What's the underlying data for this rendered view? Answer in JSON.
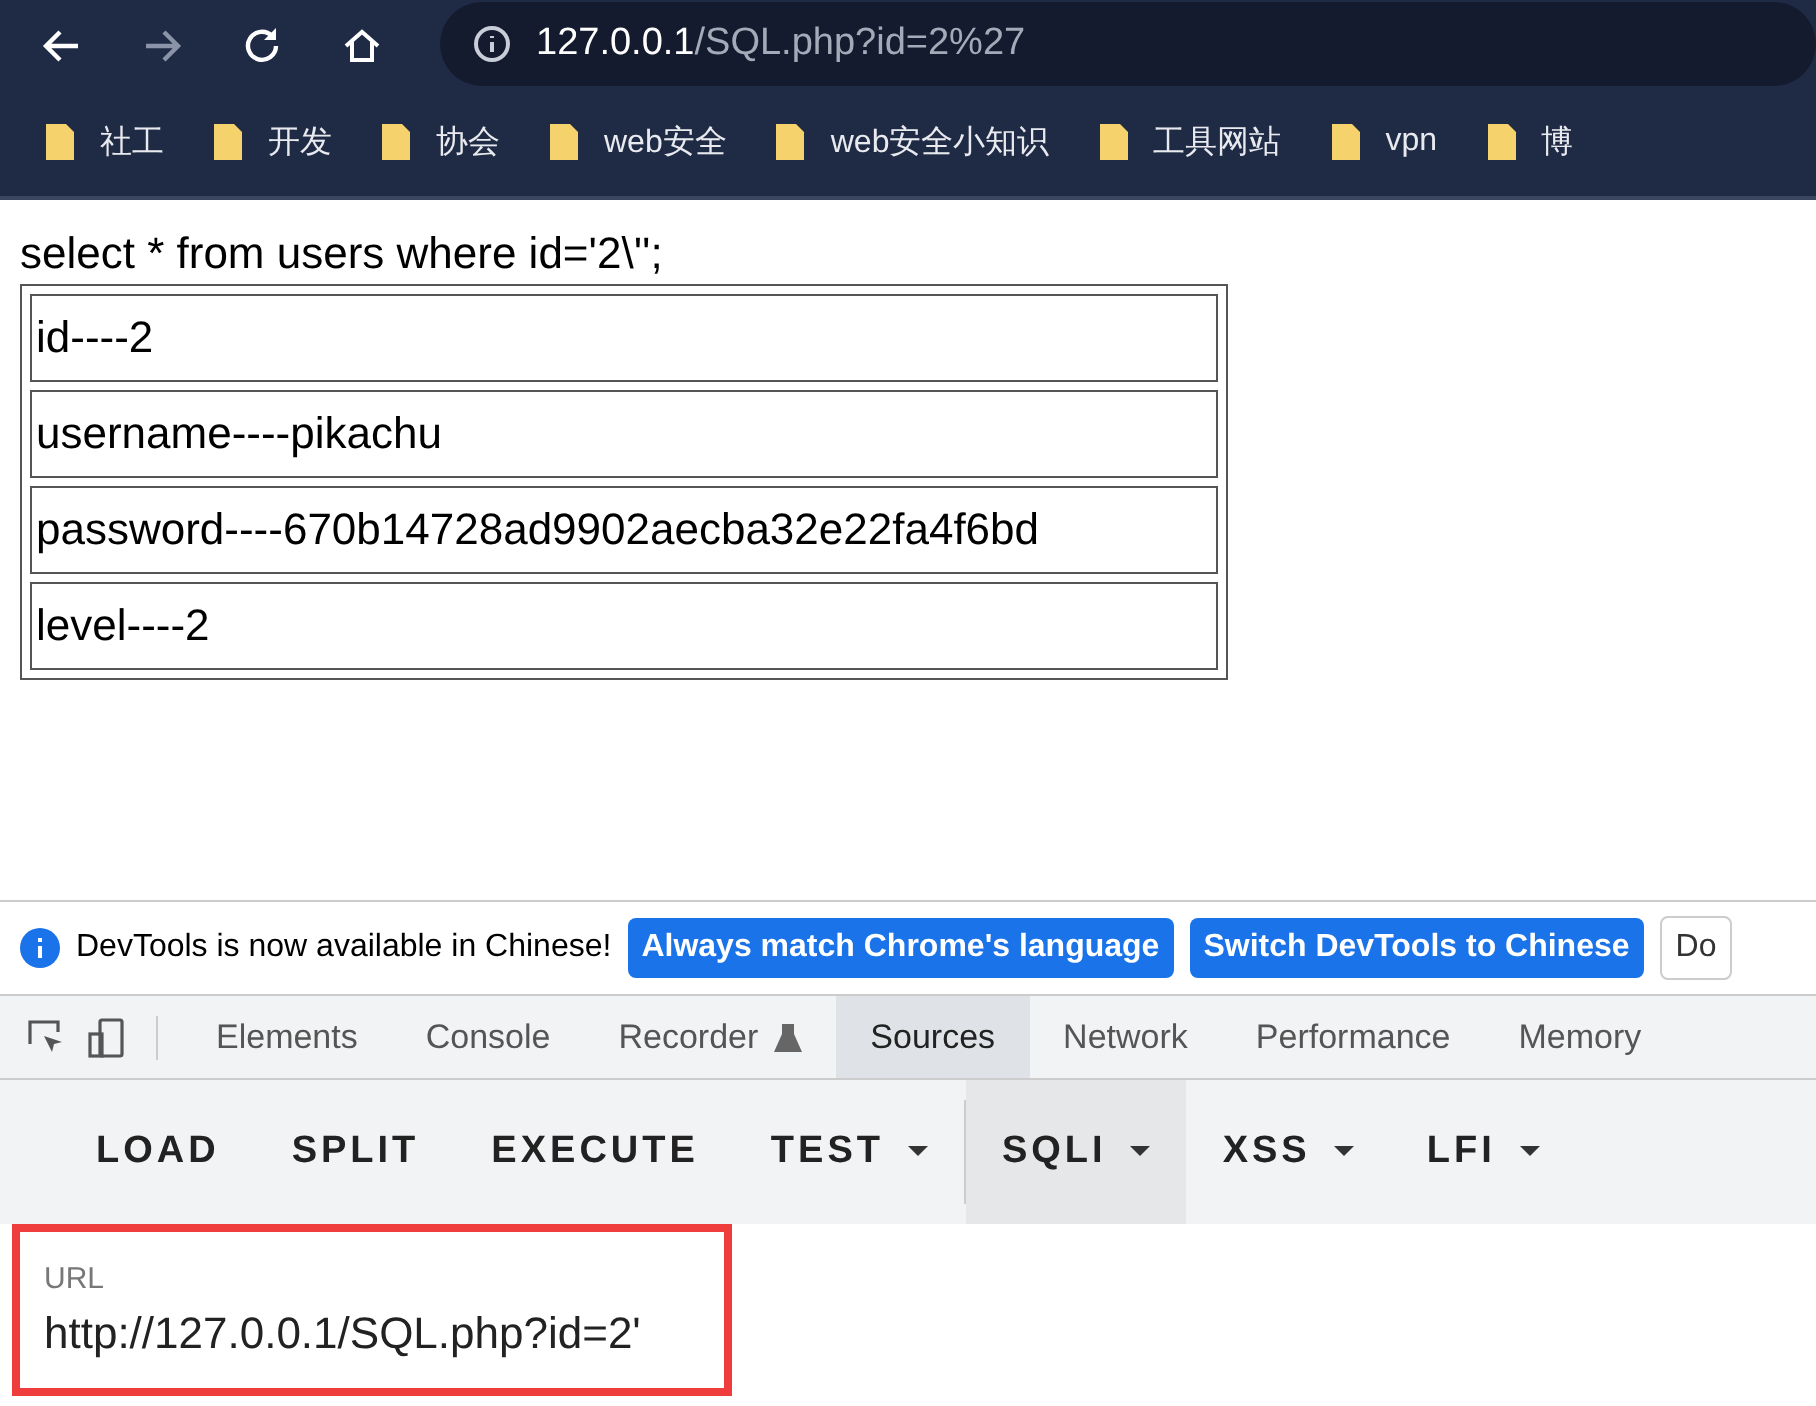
{
  "browser": {
    "address_host": "127.0.0.1",
    "address_path": "/SQL.php?id=2%27",
    "bookmarks": [
      "社工",
      "开发",
      "协会",
      "web安全",
      "web安全小知识",
      "工具网站",
      "vpn",
      "博"
    ]
  },
  "page": {
    "query": "select * from users where id='2\\'';",
    "rows": [
      "id----2",
      "username----pikachu",
      "password----670b14728ad9902aecba32e22fa4f6bd",
      "level----2"
    ]
  },
  "devtools": {
    "info": "DevTools is now available in Chinese!",
    "info_buttons": [
      {
        "label": "Always match Chrome's language",
        "kind": "primary"
      },
      {
        "label": "Switch DevTools to Chinese",
        "kind": "primary"
      },
      {
        "label": "Do",
        "kind": "plain"
      }
    ],
    "tabs": [
      {
        "label": "Elements",
        "selected": false
      },
      {
        "label": "Console",
        "selected": false
      },
      {
        "label": "Recorder",
        "selected": false,
        "flask": true
      },
      {
        "label": "Sources",
        "selected": true
      },
      {
        "label": "Network",
        "selected": false
      },
      {
        "label": "Performance",
        "selected": false
      },
      {
        "label": "Memory",
        "selected": false
      }
    ]
  },
  "hackbar": {
    "buttons": [
      {
        "label": "LOAD",
        "dropdown": false,
        "selected": false
      },
      {
        "label": "SPLIT",
        "dropdown": false,
        "selected": false
      },
      {
        "label": "EXECUTE",
        "dropdown": false,
        "selected": false
      },
      {
        "label": "TEST",
        "dropdown": true,
        "selected": false
      },
      {
        "label": "SQLI",
        "dropdown": true,
        "selected": true
      },
      {
        "label": "XSS",
        "dropdown": true,
        "selected": false
      },
      {
        "label": "LFI",
        "dropdown": true,
        "selected": false
      }
    ],
    "url_label": "URL",
    "url_value": "http://127.0.0.1/SQL.php?id=2'"
  }
}
